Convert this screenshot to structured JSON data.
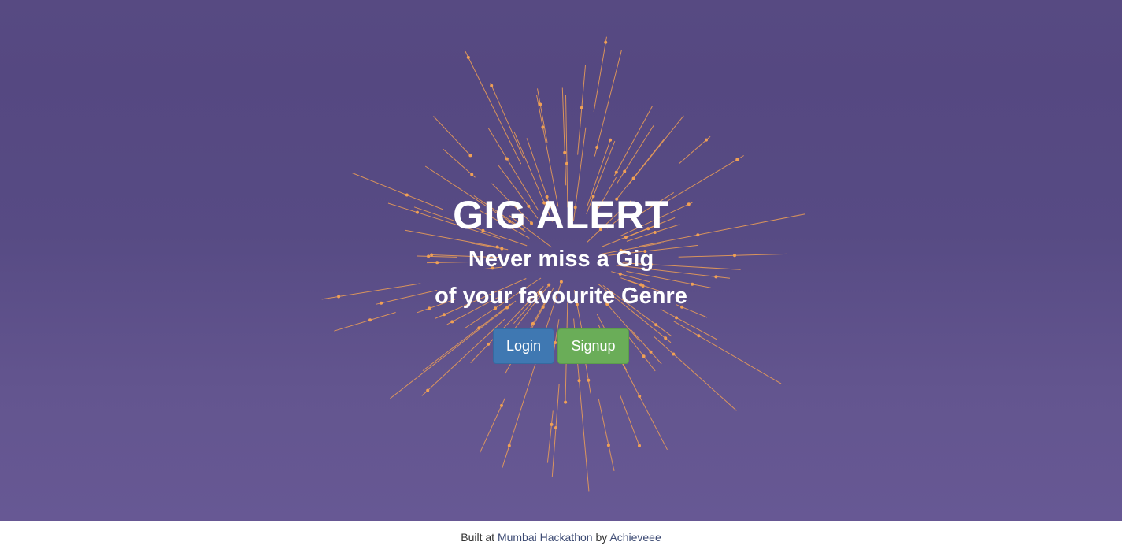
{
  "hero": {
    "title": "GIG ALERT",
    "tagline_line1": "Never miss a Gig",
    "tagline_line2": "of your favourite Genre",
    "background_color": "#5b4d88",
    "spark_color": "#f0a055"
  },
  "actions": {
    "login_label": "Login",
    "signup_label": "Signup",
    "login_color": "#3f78b2",
    "signup_color": "#6aad58"
  },
  "footer": {
    "prefix": "Built at",
    "hackathon_link": "Mumbai Hackathon",
    "by": "by",
    "author_link": "Achieveee"
  }
}
